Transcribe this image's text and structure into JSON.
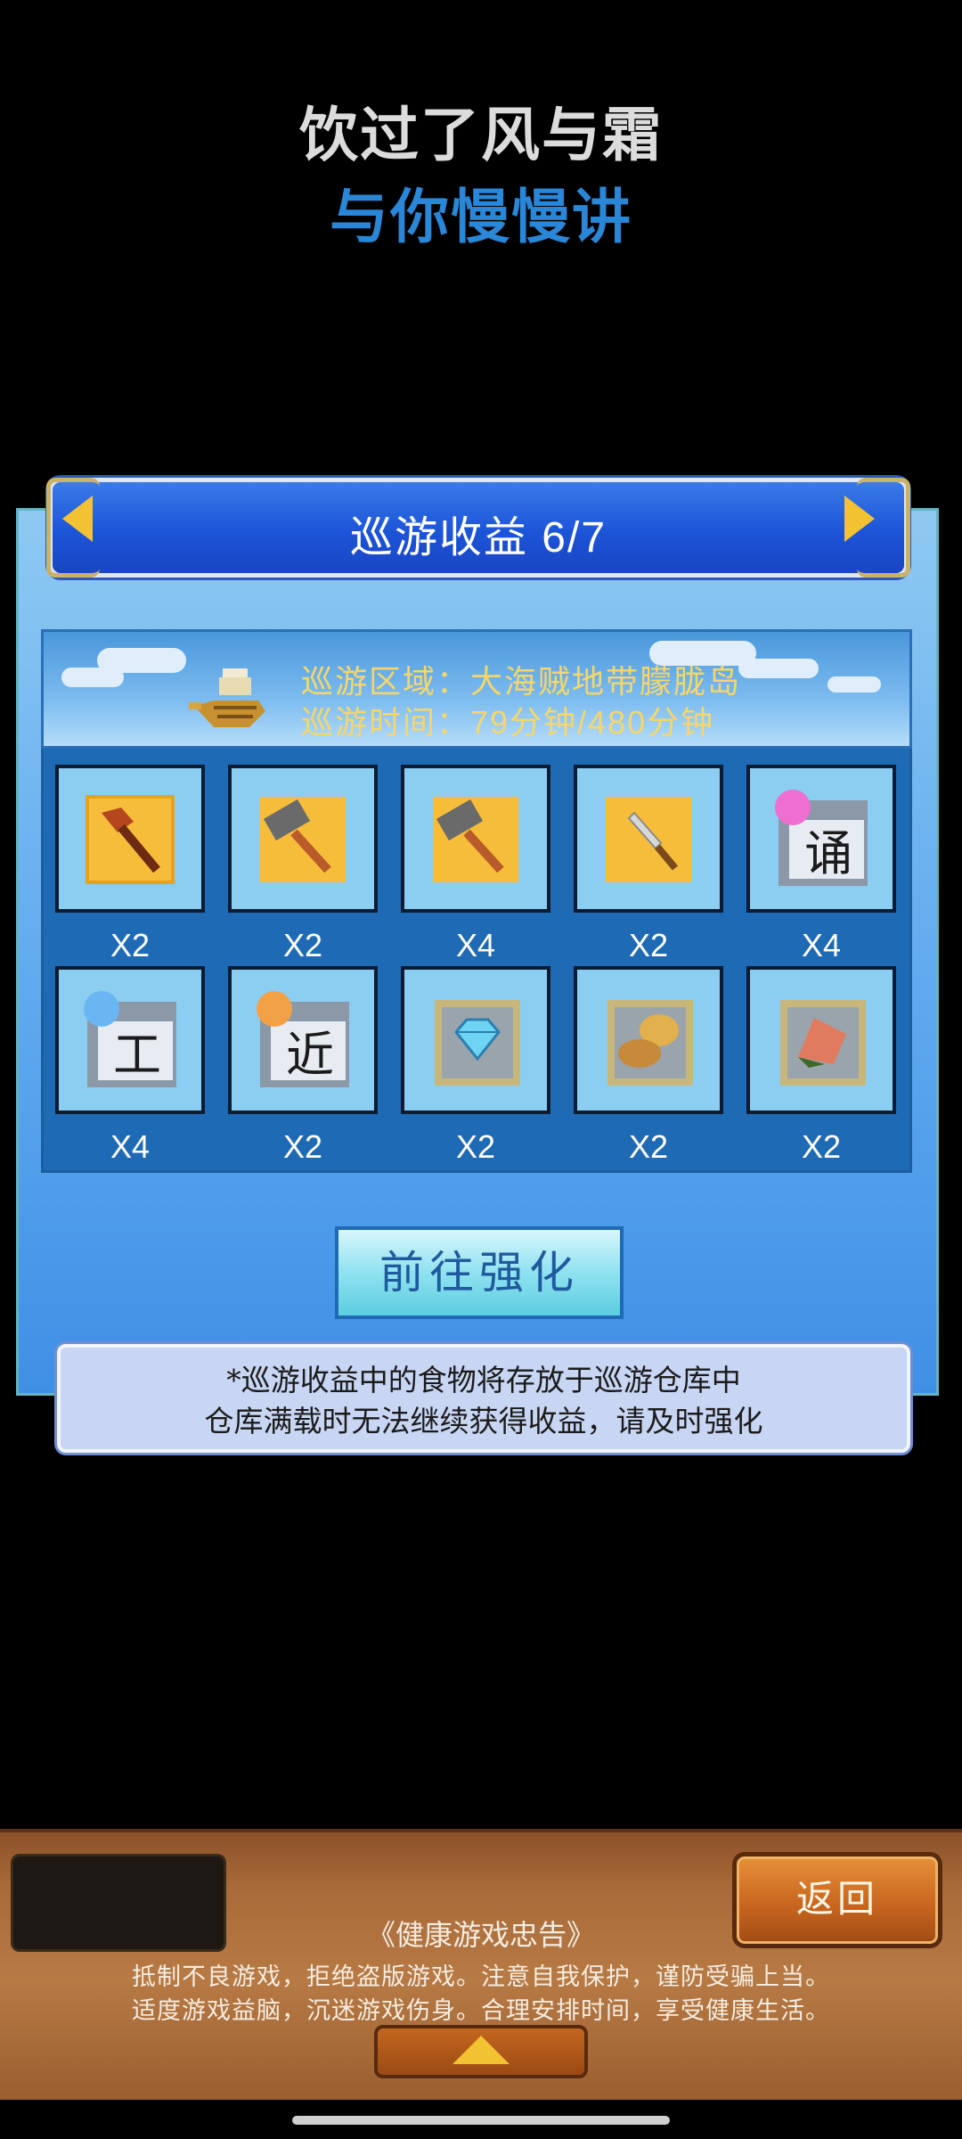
{
  "header": {
    "line1": "饮过了风与霜",
    "line2": "与你慢慢讲"
  },
  "panel": {
    "title": "巡游收益 6/7",
    "info": {
      "region_label": "巡游区域：",
      "region_value": "大海贼地带朦胧岛",
      "time_label": "巡游时间：",
      "time_value": "79分钟/480分钟"
    },
    "items": [
      {
        "icon": "wooden-club-icon",
        "qty": "X2"
      },
      {
        "icon": "hammer-icon",
        "qty": "X2"
      },
      {
        "icon": "hammer-icon",
        "qty": "X4"
      },
      {
        "icon": "dagger-icon",
        "qty": "X2"
      },
      {
        "icon": "pink-skill-scroll-icon",
        "glyph": "诵",
        "qty": "X4"
      },
      {
        "icon": "blue-skill-scroll-icon",
        "glyph": "工",
        "qty": "X4"
      },
      {
        "icon": "orange-skill-scroll-icon",
        "glyph": "近",
        "qty": "X2"
      },
      {
        "icon": "diamond-icon",
        "qty": "X2"
      },
      {
        "icon": "bread-icon",
        "qty": "X2"
      },
      {
        "icon": "meat-icon",
        "qty": "X2"
      }
    ],
    "enhance_button": "前往强化",
    "note_line1": "*巡游收益中的食物将存放于巡游仓库中",
    "note_line2": "仓库满载时无法继续获得收益，请及时强化"
  },
  "footer": {
    "back_button": "返回",
    "health_title": "《健康游戏忠告》",
    "health_line1": "抵制不良游戏，拒绝盗版游戏。注意自我保护，谨防受骗上当。",
    "health_line2": "适度游戏益脑，沉迷游戏伤身。合理安排时间，享受健康生活。"
  },
  "colors": {
    "accent_blue": "#2a86d6",
    "gold_text": "#f5d66a",
    "panel_blue": "#5fa9ef",
    "wood": "#a86a38"
  }
}
